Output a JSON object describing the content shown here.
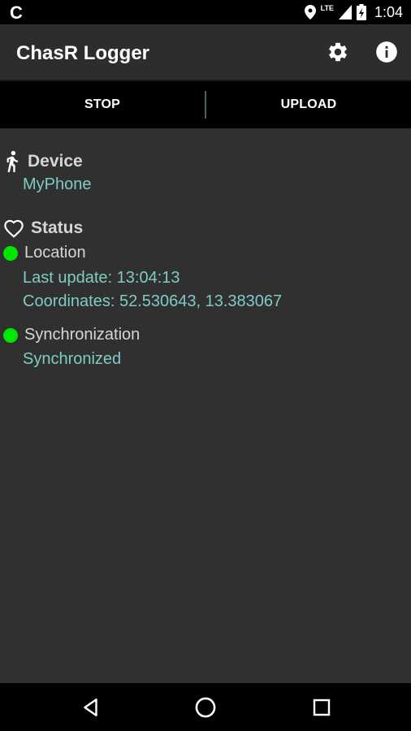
{
  "status_bar": {
    "app_glyph": "C",
    "time": "1:04",
    "network": "LTE",
    "icons": [
      "location-icon",
      "signal-icon",
      "battery-icon"
    ]
  },
  "app_bar": {
    "title": "ChasR Logger",
    "actions": [
      "settings-icon",
      "info-icon"
    ]
  },
  "buttons": {
    "stop": "STOP",
    "upload": "UPLOAD"
  },
  "device": {
    "heading": "Device",
    "icon": "walking-person-icon",
    "name": "MyPhone"
  },
  "status": {
    "heading": "Status",
    "icon": "heart-icon",
    "location": {
      "label": "Location",
      "last_update": "Last update: 13:04:13",
      "coordinates": "Coordinates: 52.530643, 13.383067",
      "indicator_color": "#00e600"
    },
    "sync": {
      "label": "Synchronization",
      "state": "Synchronized",
      "indicator_color": "#00e600"
    }
  },
  "colors": {
    "accent": "#80cbc4",
    "background": "#303030",
    "label": "#d6d6d6",
    "ok": "#00e600"
  },
  "nav_bar": [
    "back-icon",
    "home-icon",
    "recents-icon"
  ]
}
